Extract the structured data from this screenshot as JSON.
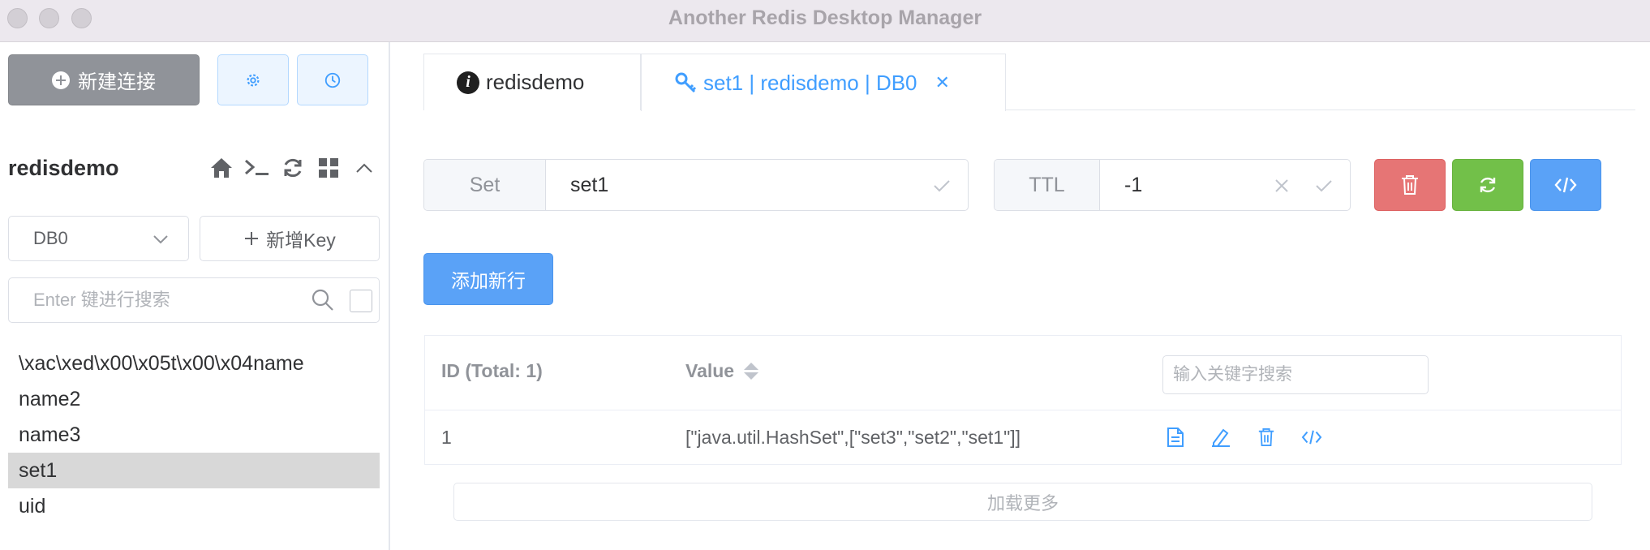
{
  "window": {
    "title": "Another Redis Desktop Manager"
  },
  "sidebar": {
    "new_connection_label": "新建连接",
    "connection_name": "redisdemo",
    "db_select_value": "DB0",
    "add_key_label": "新增Key",
    "search_placeholder": "Enter 键进行搜索",
    "keys": [
      {
        "name": "\\xac\\xed\\x00\\x05t\\x00\\x04name",
        "selected": false
      },
      {
        "name": "name2",
        "selected": false
      },
      {
        "name": "name3",
        "selected": false
      },
      {
        "name": "set1",
        "selected": true
      },
      {
        "name": "uid",
        "selected": false
      }
    ]
  },
  "tabs": [
    {
      "label": "redisdemo",
      "icon": "info-icon",
      "active": false
    },
    {
      "label": "set1 | redisdemo | DB0",
      "icon": "key-icon",
      "active": true
    }
  ],
  "key_detail": {
    "type_label": "Set",
    "key_name": "set1",
    "ttl_label": "TTL",
    "ttl_value": "-1",
    "add_row_label": "添加新行",
    "load_more_label": "加载更多"
  },
  "table": {
    "headers": {
      "id": "ID (Total: 1)",
      "value": "Value"
    },
    "search_placeholder": "输入关键字搜索",
    "rows": [
      {
        "id": "1",
        "value": "[\"java.util.HashSet\",[\"set3\",\"set2\",\"set1\"]]"
      }
    ]
  },
  "colors": {
    "primary": "#409eff",
    "danger": "#e67575",
    "success": "#72c049",
    "info": "#909399",
    "selected_row": "#d8d8d8"
  }
}
